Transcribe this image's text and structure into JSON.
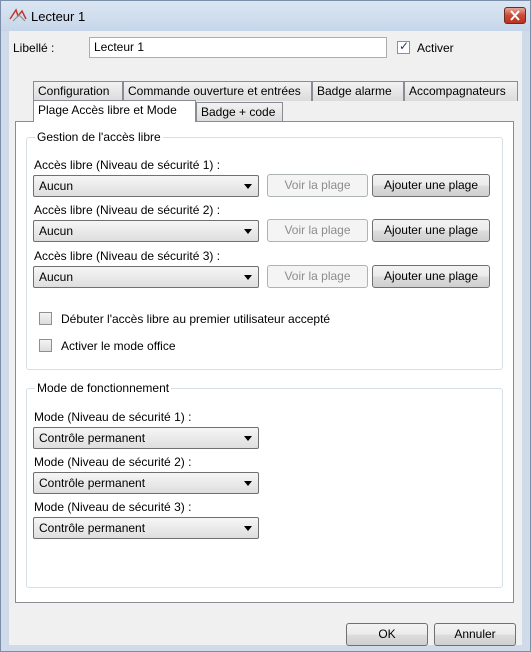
{
  "window": {
    "title": "Lecteur 1"
  },
  "general": {
    "name_label": "Libellé :",
    "name_value": "Lecteur 1",
    "activate_label": "Activer",
    "activate_checked": true
  },
  "tabs": {
    "row1": [
      "Configuration",
      "Commande ouverture et entrées",
      "Badge alarme",
      "Accompagnateurs"
    ],
    "row2": [
      "Plage Accès libre et Mode",
      "Badge + code"
    ],
    "active": "Plage Accès libre et Mode"
  },
  "free_access": {
    "title": "Gestion de l'accès libre",
    "levels": [
      {
        "label": "Accès libre (Niveau de sécurité 1) :",
        "value": "Aucun"
      },
      {
        "label": "Accès libre (Niveau de sécurité 2) :",
        "value": "Aucun"
      },
      {
        "label": "Accès libre (Niveau de sécurité 3) :",
        "value": "Aucun"
      }
    ],
    "view_button": "Voir la plage",
    "add_button": "Ajouter une plage",
    "option_first_user": "Débuter l'accès libre au premier utilisateur accepté",
    "option_office_mode": "Activer le mode office"
  },
  "operating_mode": {
    "title": "Mode de fonctionnement",
    "levels": [
      {
        "label": "Mode (Niveau de sécurité 1) :",
        "value": "Contrôle permanent"
      },
      {
        "label": "Mode (Niveau de sécurité 2) :",
        "value": "Contrôle permanent"
      },
      {
        "label": "Mode (Niveau de sécurité 3) :",
        "value": "Contrôle permanent"
      }
    ]
  },
  "footer": {
    "ok": "OK",
    "cancel": "Annuler"
  },
  "colors": {
    "frame": "#cfdbe9",
    "close": "#c94a36",
    "client": "#f0f0f0"
  }
}
